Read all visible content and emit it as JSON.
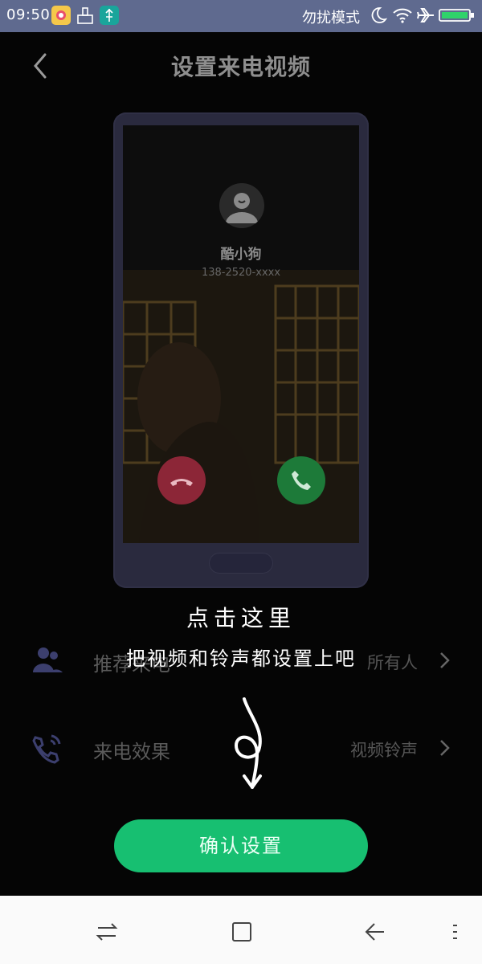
{
  "status_bar": {
    "time": "09:50",
    "dnd_label": "勿扰模式"
  },
  "header": {
    "title": "设置来电视频"
  },
  "preview": {
    "caller_name": "酷小狗",
    "caller_number": "138-2520-xxxx"
  },
  "overlay": {
    "line1": "点击这里",
    "line2": "把视频和铃声都设置上吧"
  },
  "settings": {
    "rows": [
      {
        "label": "推荐来电",
        "value": "所有人",
        "icon": "contacts-icon"
      },
      {
        "label": "来电效果",
        "value": "视频铃声",
        "icon": "ringing-phone-icon"
      }
    ]
  },
  "actions": {
    "confirm_label": "确认设置"
  },
  "colors": {
    "accent_green": "#17bf71",
    "status_bar": "#5f6a8f",
    "decline_red": "#8c2637",
    "accept_green": "#1d7a39"
  }
}
